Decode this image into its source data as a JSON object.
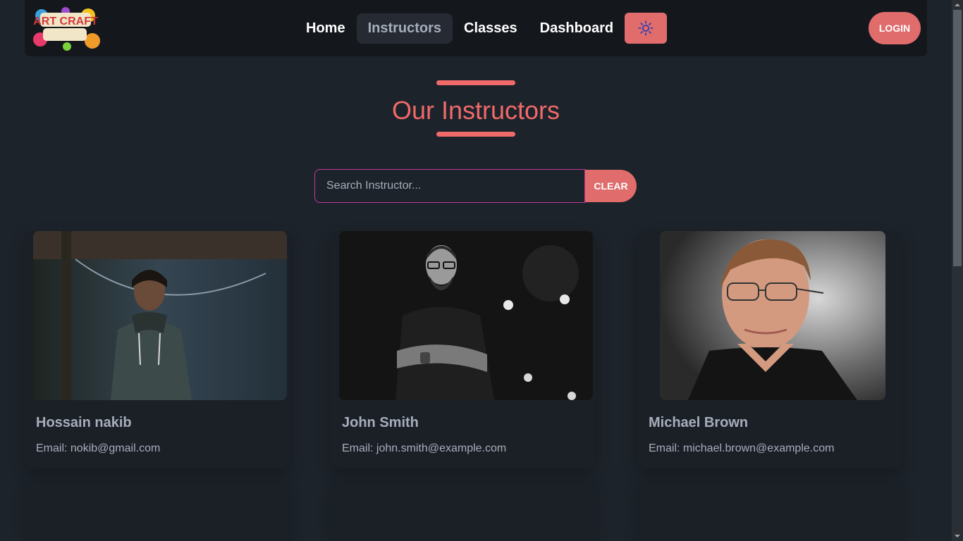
{
  "nav": {
    "logo_text": "ART CRAFT",
    "links": [
      "Home",
      "Instructors",
      "Classes",
      "Dashboard"
    ],
    "active": "Instructors",
    "theme_icon": "sun-icon",
    "login_label": "LOGIN"
  },
  "main": {
    "title": "Our Instructors",
    "search": {
      "placeholder": "Search Instructor...",
      "value": "",
      "clear_label": "CLEAR"
    },
    "instructors": [
      {
        "name": "Hossain nakib",
        "email": "Email: nokib@gmail.com"
      },
      {
        "name": "John Smith",
        "email": "Email: john.smith@example.com"
      },
      {
        "name": "Michael Brown",
        "email": "Email: michael.brown@example.com"
      }
    ]
  },
  "colors": {
    "accent": "#f06a6a",
    "button": "#e06c6c",
    "background": "#1d232a",
    "navbar": "#14181d",
    "search_border": "#c0399a"
  }
}
